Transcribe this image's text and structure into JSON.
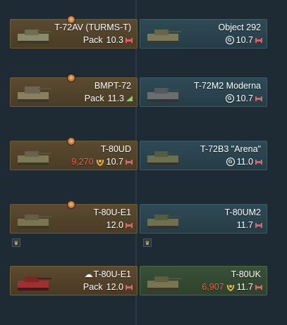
{
  "colors": {
    "rp_red": "#ff5a4a",
    "premium": "#4a3c26",
    "squadron": "#263d47",
    "researched": "#2e422c"
  },
  "cards": [
    {
      "name": "T-72AV (TURMS-T)",
      "pack": "Pack",
      "br": "10.3",
      "rp": "",
      "medal": true
    },
    {
      "name": "Object 292",
      "pack": "",
      "br": "10.7",
      "rp": ""
    },
    {
      "name": "BMPT-72",
      "pack": "Pack",
      "br": "11.3",
      "rp": "",
      "medal": true
    },
    {
      "name": "T-72M2 Moderna",
      "pack": "",
      "br": "10.7",
      "rp": ""
    },
    {
      "name": "T-80UD",
      "pack": "",
      "br": "10.7",
      "rp": "9,270",
      "medal": true
    },
    {
      "name": "T-72B3 \"Arena\"",
      "pack": "",
      "br": "11.0",
      "rp": ""
    },
    {
      "name": "T-80U-E1",
      "pack": "",
      "br": "12.0",
      "rp": "",
      "medal": true
    },
    {
      "name": "T-80UM2",
      "pack": "",
      "br": "11.7",
      "rp": ""
    },
    {
      "name": "T-80U-E1",
      "pack": "Pack",
      "br": "12.0",
      "rp": ""
    },
    {
      "name": "T-80UK",
      "pack": "",
      "br": "11.7",
      "rp": "6,907"
    }
  ],
  "icons": [
    "medal-icon",
    "rank-icon",
    "gaijin-coin-icon",
    "wreath-icon",
    "squadron-badge-icon",
    "cloud-icon"
  ]
}
